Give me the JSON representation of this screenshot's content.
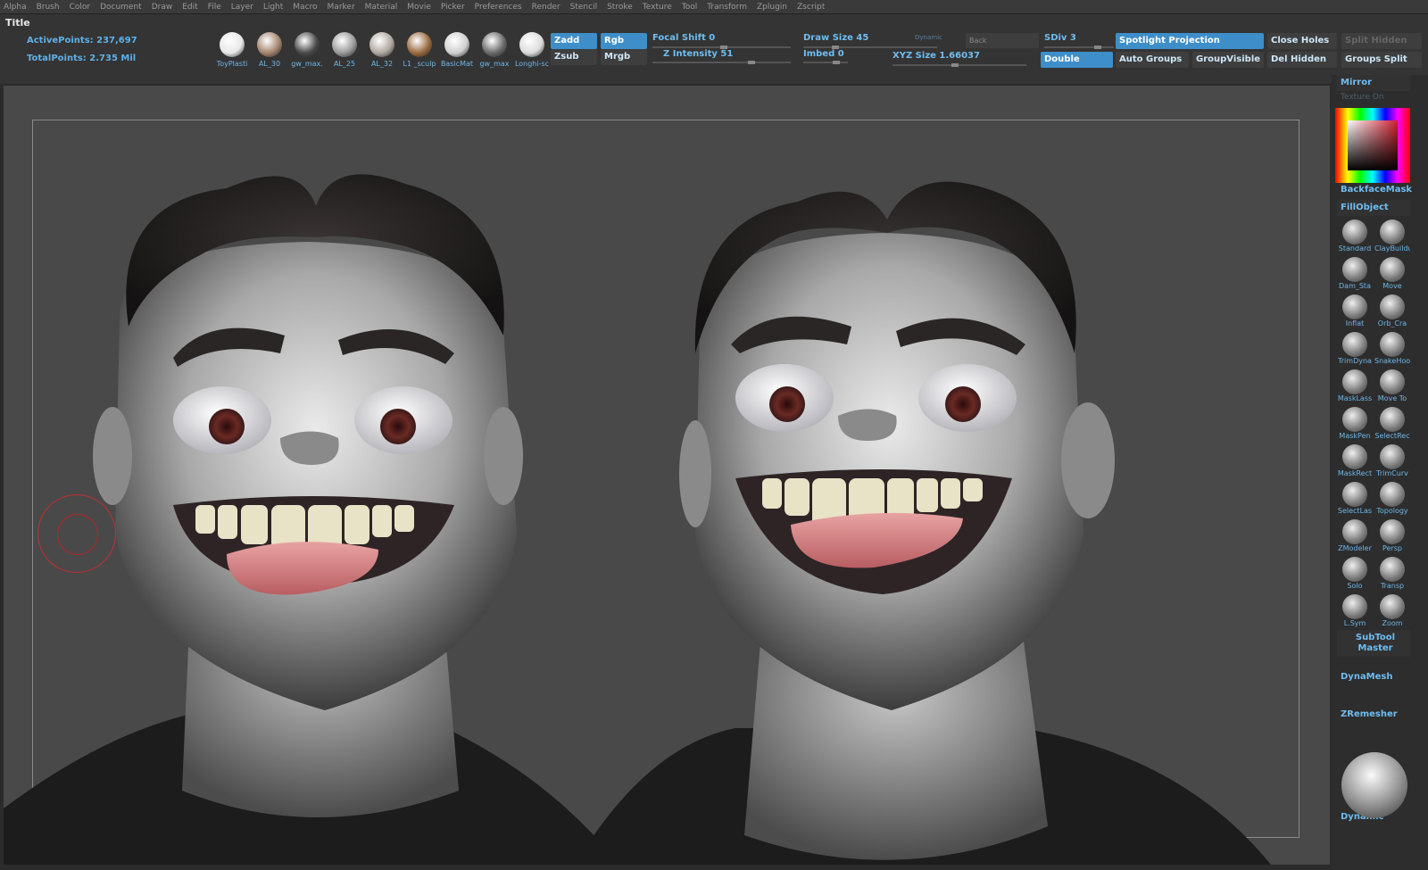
{
  "menu": [
    "Alpha",
    "Brush",
    "Color",
    "Document",
    "Draw",
    "Edit",
    "File",
    "Layer",
    "Light",
    "Macro",
    "Marker",
    "Material",
    "Movie",
    "Picker",
    "Preferences",
    "Render",
    "Stencil",
    "Stroke",
    "Texture",
    "Tool",
    "Transform",
    "Zplugin",
    "Zscript"
  ],
  "shelf": {
    "title": "Title",
    "active_points": "ActivePoints: 237,697",
    "total_points": "TotalPoints: 2.735  Mil",
    "materials": [
      {
        "label": "ToyPlasti",
        "color": "#e8e8e8"
      },
      {
        "label": "AL_30",
        "color": "#a58470"
      },
      {
        "label": "gw_max.",
        "color": "#4a4a4a"
      },
      {
        "label": "AL_25",
        "color": "#9a9a9a"
      },
      {
        "label": "AL_32",
        "color": "#b0a8a0"
      },
      {
        "label": "L1 _sculp",
        "color": "#9a6a40"
      },
      {
        "label": "BasicMat",
        "color": "#d0d0d0"
      },
      {
        "label": "gw_max",
        "color": "#6a6a6a"
      },
      {
        "label": "Longhi-sc",
        "color": "#dcdcdc"
      }
    ],
    "zadd": "Zadd",
    "zsub": "Zsub",
    "rgb": "Rgb",
    "mrgb": "Mrgb",
    "focal_shift": "Focal Shift 0",
    "z_intensity": "Z Intensity 51",
    "draw_size": "Draw Size 45",
    "dynamic": "Dynamic",
    "imbed": "Imbed 0",
    "xyz_size": "XYZ Size 1.66037",
    "back": "Back",
    "sdiv": "SDiv 3",
    "double": "Double",
    "spotlight": "Spotlight Projection",
    "close_holes": "Close Holes",
    "split_hidden": "Split Hidden",
    "auto_groups": "Auto Groups",
    "group_visible": "GroupVisible",
    "del_hidden": "Del Hidden",
    "groups_split": "Groups Split"
  },
  "tray": {
    "mirror": "Mirror",
    "texture_on": "Texture On",
    "backface": "BackfaceMask",
    "fillobject": "FillObject",
    "brushes": [
      "Standard",
      "ClayBuildu",
      "Dam_Sta",
      "Move",
      "Inflat",
      "Orb_Cra",
      "TrimDyna",
      "SnakeHoo",
      "MaskLass",
      "Move To",
      "MaskPen",
      "SelectRec",
      "MaskRect",
      "TrimCurv",
      "SelectLas",
      "Topology",
      "ZModeler",
      "Persp",
      "Solo",
      "Transp",
      "L.Sym",
      "Zoom"
    ],
    "dynamic_label": "Dynamic",
    "subtool": "SubTool Master",
    "dynamesh": "DynaMesh",
    "zremesher": "ZRemesher",
    "dynamic_bottom": "Dynamic"
  }
}
